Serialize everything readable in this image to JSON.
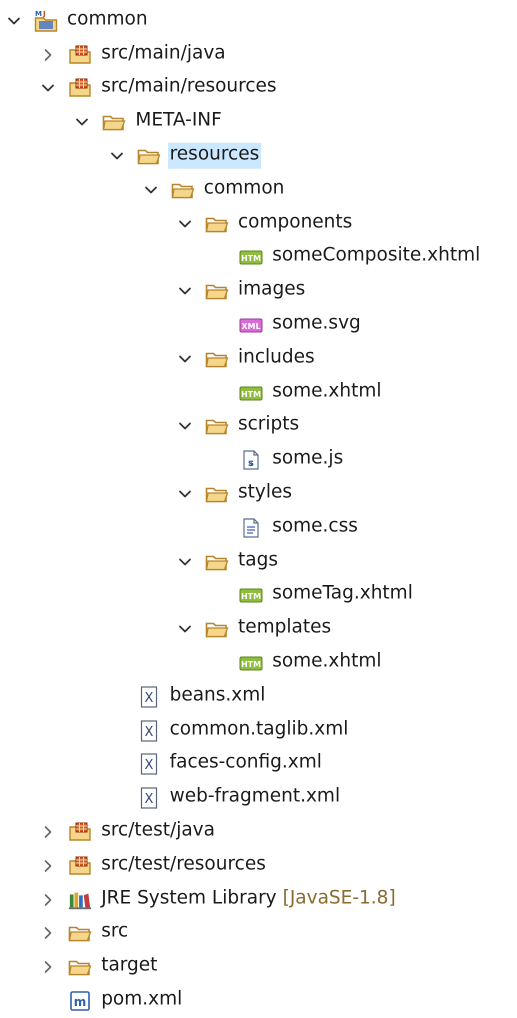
{
  "tree": {
    "rows": [
      {
        "label": "common",
        "level": 0,
        "expanded": true,
        "icon": "project-icon"
      },
      {
        "label": "src/main/java",
        "level": 1,
        "expanded": false,
        "icon": "source-folder-icon"
      },
      {
        "label": "src/main/resources",
        "level": 1,
        "expanded": true,
        "icon": "source-folder-icon"
      },
      {
        "label": "META-INF",
        "level": 2,
        "expanded": true,
        "icon": "folder-icon"
      },
      {
        "label": "resources",
        "level": 3,
        "expanded": true,
        "icon": "folder-icon",
        "selected": true
      },
      {
        "label": "common",
        "level": 4,
        "expanded": true,
        "icon": "folder-icon"
      },
      {
        "label": "components",
        "level": 5,
        "expanded": true,
        "icon": "folder-icon"
      },
      {
        "label": "someComposite.xhtml",
        "level": 6,
        "icon": "html-file-icon"
      },
      {
        "label": "images",
        "level": 5,
        "expanded": true,
        "icon": "folder-icon"
      },
      {
        "label": "some.svg",
        "level": 6,
        "icon": "xml-file-icon"
      },
      {
        "label": "includes",
        "level": 5,
        "expanded": true,
        "icon": "folder-icon"
      },
      {
        "label": "some.xhtml",
        "level": 6,
        "icon": "html-file-icon"
      },
      {
        "label": "scripts",
        "level": 5,
        "expanded": true,
        "icon": "folder-icon"
      },
      {
        "label": "some.js",
        "level": 6,
        "icon": "js-file-icon"
      },
      {
        "label": "styles",
        "level": 5,
        "expanded": true,
        "icon": "folder-icon"
      },
      {
        "label": "some.css",
        "level": 6,
        "icon": "css-file-icon"
      },
      {
        "label": "tags",
        "level": 5,
        "expanded": true,
        "icon": "folder-icon"
      },
      {
        "label": "someTag.xhtml",
        "level": 6,
        "icon": "html-file-icon"
      },
      {
        "label": "templates",
        "level": 5,
        "expanded": true,
        "icon": "folder-icon"
      },
      {
        "label": "some.xhtml",
        "level": 6,
        "icon": "html-file-icon"
      },
      {
        "label": "beans.xml",
        "level": 3,
        "icon": "xml-x-file-icon"
      },
      {
        "label": "common.taglib.xml",
        "level": 3,
        "icon": "xml-x-file-icon"
      },
      {
        "label": "faces-config.xml",
        "level": 3,
        "icon": "xml-x-file-icon"
      },
      {
        "label": "web-fragment.xml",
        "level": 3,
        "icon": "xml-x-file-icon"
      },
      {
        "label": "src/test/java",
        "level": 1,
        "expanded": false,
        "icon": "source-folder-icon"
      },
      {
        "label": "src/test/resources",
        "level": 1,
        "expanded": false,
        "icon": "source-folder-icon"
      },
      {
        "label": "JRE System Library",
        "decoration": "[JavaSE-1.8]",
        "level": 1,
        "expanded": false,
        "icon": "library-icon"
      },
      {
        "label": "src",
        "level": 1,
        "expanded": false,
        "icon": "folder-icon"
      },
      {
        "label": "target",
        "level": 1,
        "expanded": false,
        "icon": "folder-icon"
      },
      {
        "label": "pom.xml",
        "level": 1,
        "icon": "maven-pom-icon"
      }
    ]
  },
  "colors": {
    "selection": "#cce8ff",
    "folder_fill": "#f6d68a",
    "folder_stroke": "#b7862c",
    "decoration_text": "#8b6a2e"
  }
}
